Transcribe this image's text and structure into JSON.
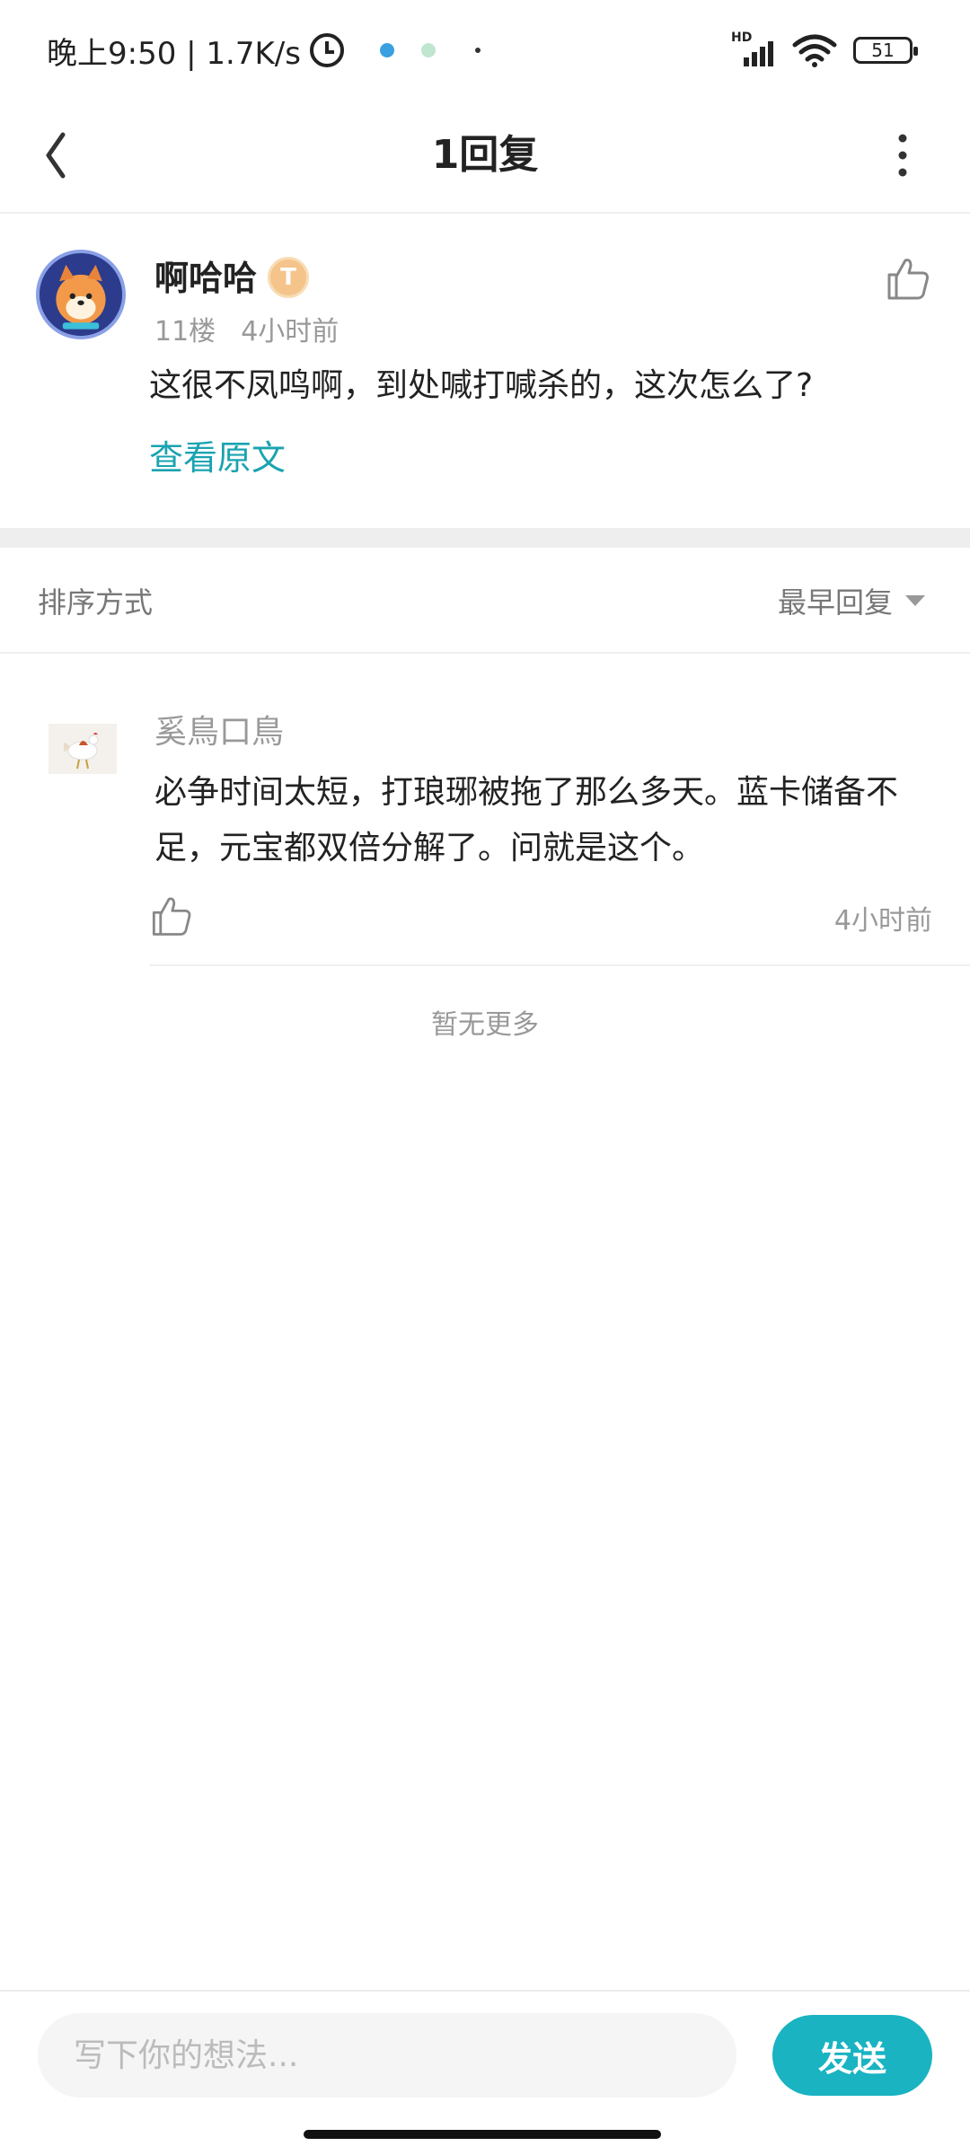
{
  "status_bar": {
    "time_speed": "晚上9:50 | 1.7K/s",
    "signal_label": "HD",
    "battery_level": "51",
    "icons": [
      "alarm-icon",
      "app-notification-icon",
      "signal-icon",
      "wifi-icon",
      "battery-icon"
    ]
  },
  "header": {
    "title": "1回复",
    "icons": [
      "back-icon",
      "more-vertical-icon"
    ]
  },
  "original_comment": {
    "username": "啊哈哈",
    "level_badge": "T",
    "floor": "11楼",
    "time": "4小时前",
    "content": "这很不凤鸣啊，到处喊打喊杀的，这次怎么了?",
    "view_original_label": "查看原文",
    "like_icon": "thumbs-up-icon"
  },
  "sort": {
    "label": "排序方式",
    "value": "最早回复"
  },
  "replies": [
    {
      "username": "奚鳥口鳥",
      "content": "必争时间太短，打琅琊被拖了那么多天。蓝卡储备不足，元宝都双倍分解了。问就是这个。",
      "time": "4小时前"
    }
  ],
  "no_more_label": "暂无更多",
  "input": {
    "placeholder": "写下你的想法...",
    "value": ""
  },
  "send_label": "发送",
  "colors": {
    "accent": "#19b3c2",
    "link": "#1aa3b0",
    "muted_text": "#999999"
  }
}
